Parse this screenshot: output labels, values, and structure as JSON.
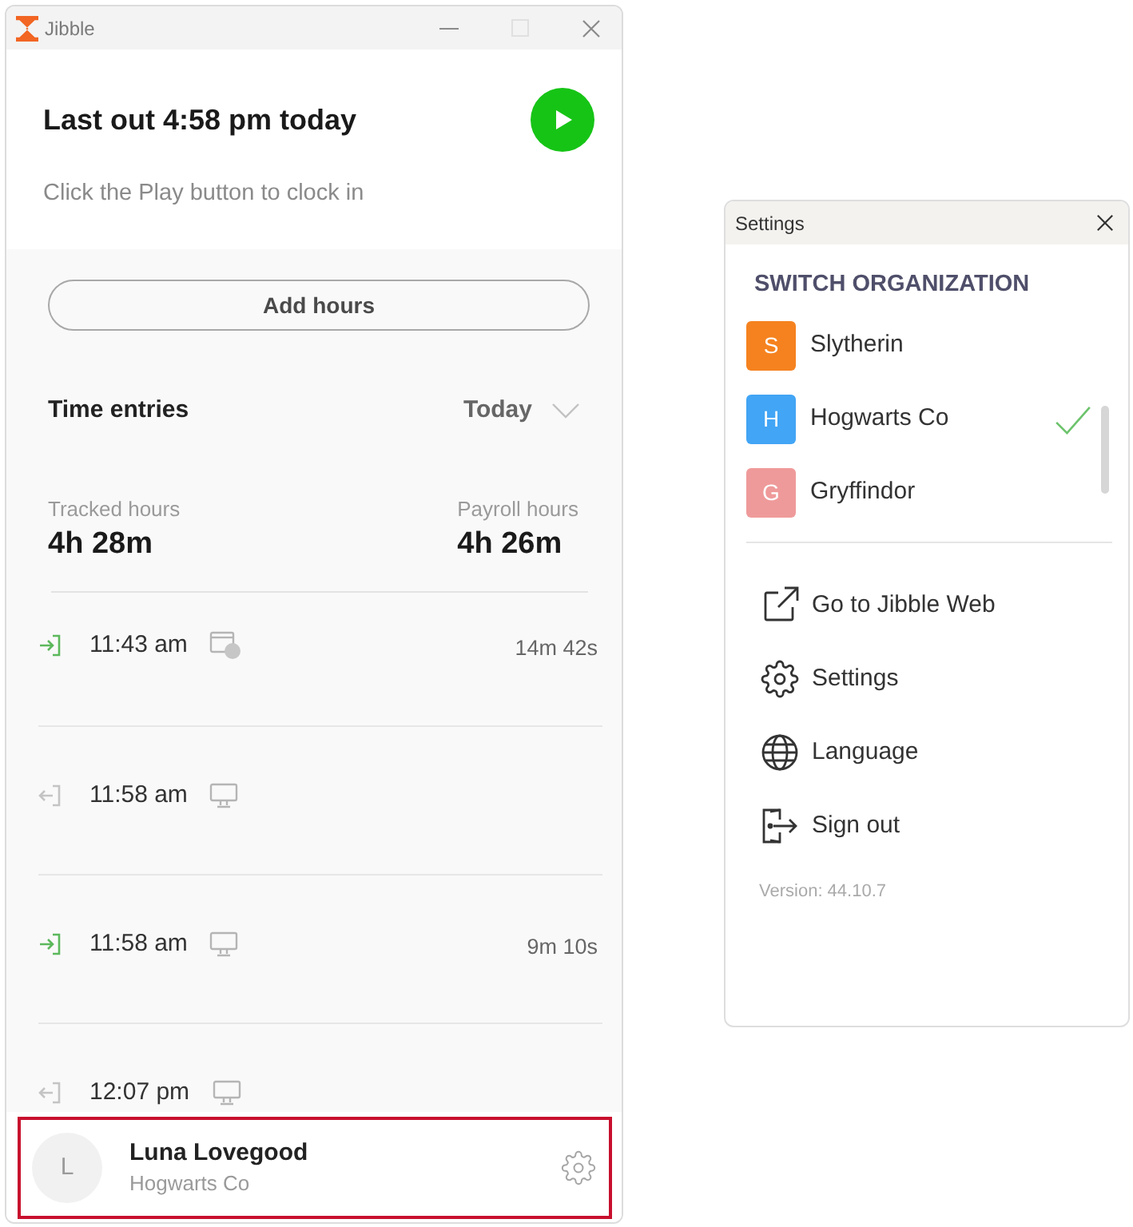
{
  "main_window": {
    "title": "Jibble",
    "maximize_disabled": true,
    "status": {
      "heading": "Last out 4:58 pm today",
      "hint": "Click the Play button to clock in"
    },
    "add_hours_button": "Add hours",
    "time_entries": {
      "title": "Time entries",
      "period": "Today",
      "stats": [
        {
          "label": "Tracked hours",
          "value": "4h 28m"
        },
        {
          "label": "Payroll hours",
          "value": "4h 26m"
        }
      ],
      "entries": [
        {
          "kind": "in",
          "time": "11:43 am",
          "device": {
            "kind": "browser"
          },
          "duration": "14m 42s"
        },
        {
          "kind": "out",
          "time": "11:58 am",
          "device": {
            "kind": "desktop"
          }
        },
        {
          "kind": "in",
          "time": "11:58 am",
          "device": {
            "kind": "desktop"
          },
          "duration": "9m 10s"
        },
        {
          "kind": "out",
          "time": "12:07 pm",
          "device": {
            "kind": "desktop"
          }
        }
      ]
    },
    "user": {
      "initial": "L",
      "name": "Luna Lovegood",
      "organization": "Hogwarts Co",
      "highlighted": true
    }
  },
  "settings_window": {
    "title": "Settings",
    "section_title": "SWITCH ORGANIZATION",
    "organizations": [
      {
        "initial": "S",
        "name": "Slytherin",
        "color": "#f5821f",
        "selected": false
      },
      {
        "initial": "H",
        "name": "Hogwarts Co",
        "color": "#42a5f5",
        "selected": true
      },
      {
        "initial": "G",
        "name": "Gryffindor",
        "color": "#ef9a9a",
        "selected": false
      }
    ],
    "menu": [
      {
        "kind": "web",
        "label": "Go to Jibble Web"
      },
      {
        "kind": "settings",
        "label": "Settings"
      },
      {
        "kind": "language",
        "label": "Language"
      },
      {
        "kind": "sign_out",
        "label": "Sign out"
      }
    ],
    "version": "Version: 44.10.7"
  }
}
